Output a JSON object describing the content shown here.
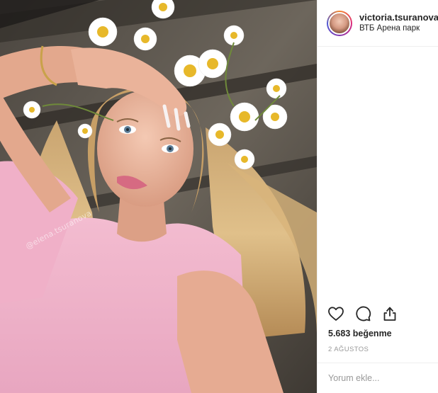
{
  "header": {
    "username": "victoria.tsuranova",
    "location": "ВТБ Арена парк"
  },
  "photo": {
    "watermark": "@elena.tsuranova"
  },
  "actions": {
    "like_icon": "heart-icon",
    "comment_icon": "comment-icon",
    "share_icon": "share-icon"
  },
  "likes_text": "5.683 beğenme",
  "date_text": "2 AĞUSTOS",
  "comment": {
    "placeholder": "Yorum ekle...",
    "value": ""
  },
  "colors": {
    "text": "#262626",
    "muted": "#999999",
    "border": "#efefef"
  }
}
